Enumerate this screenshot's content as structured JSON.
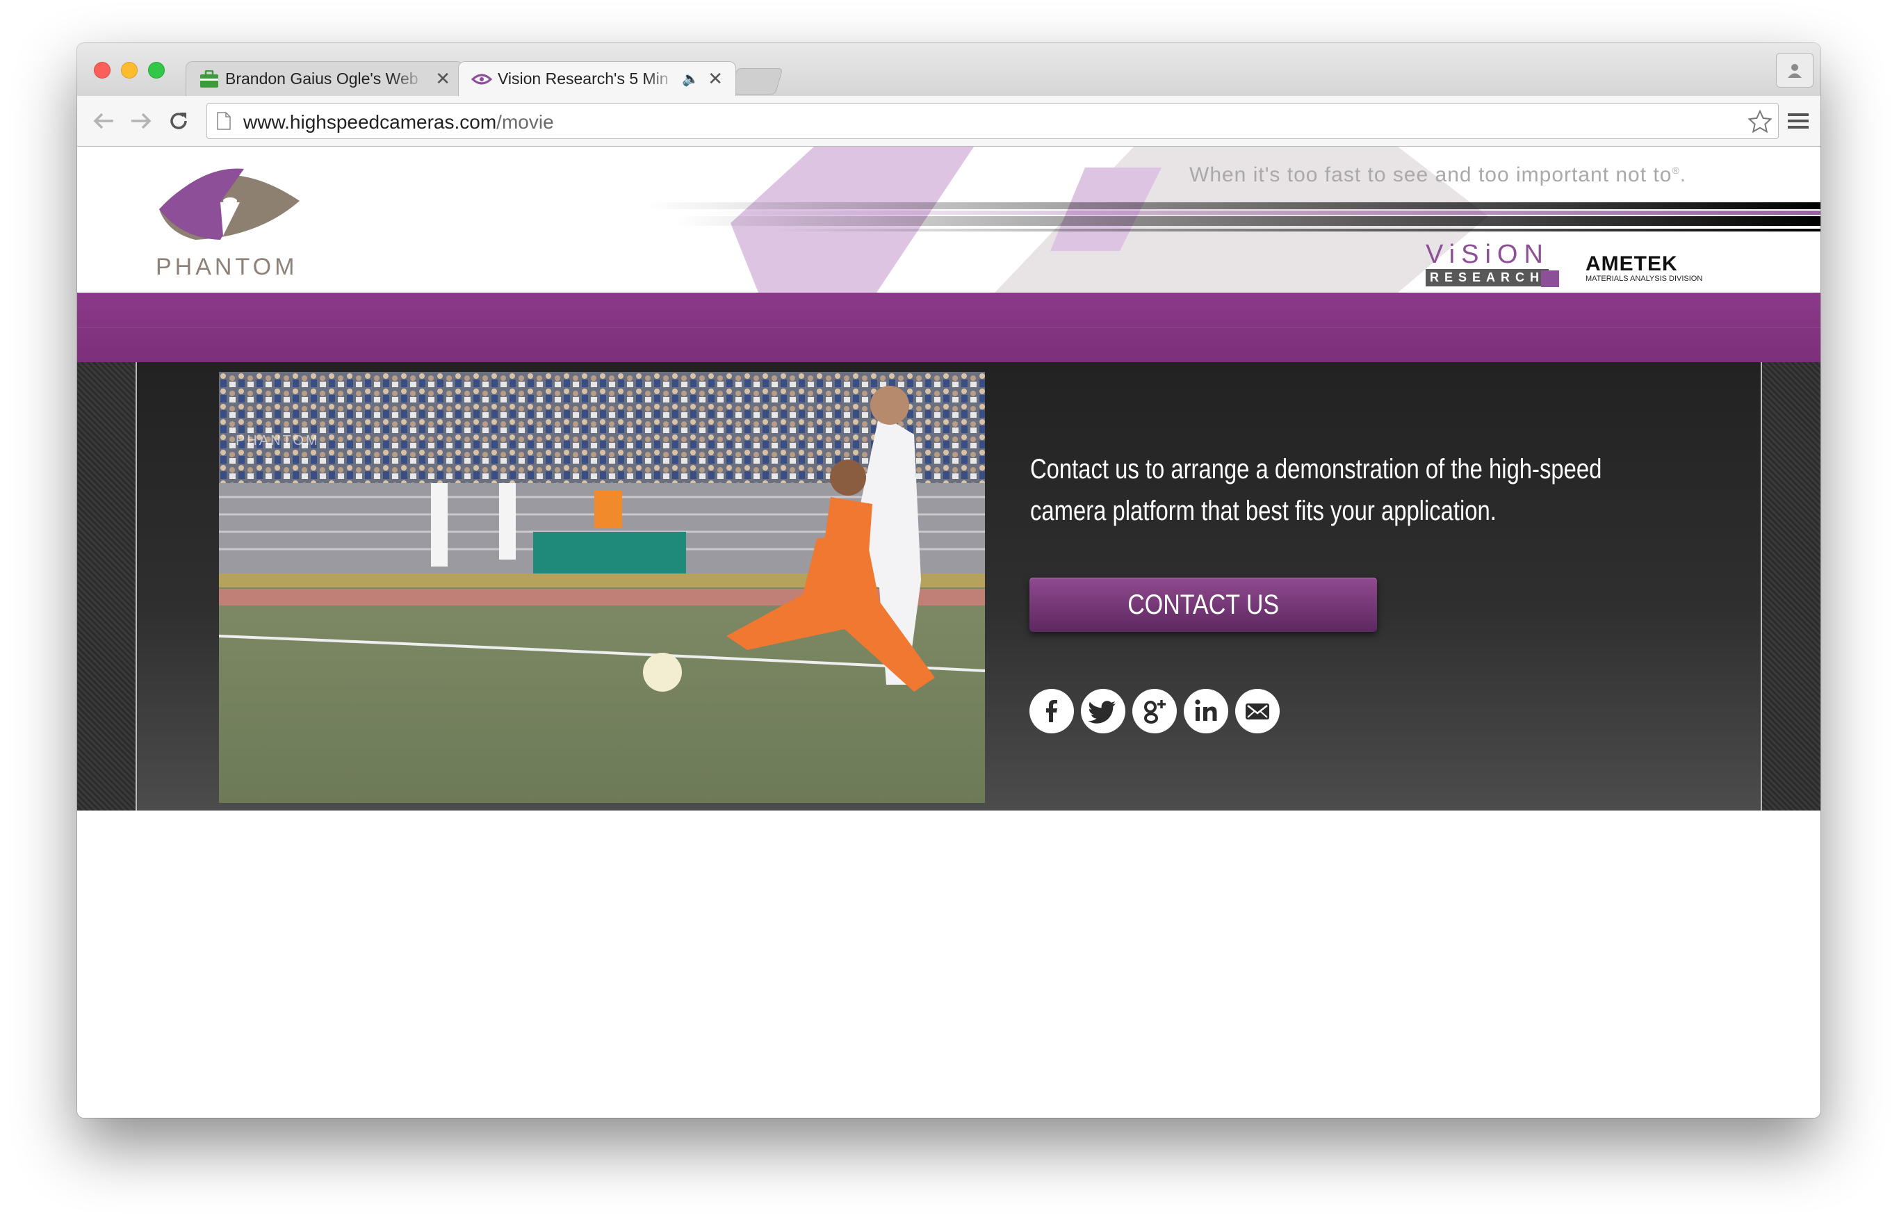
{
  "browser": {
    "tabs": [
      {
        "title": "Brandon Gaius Ogle's Web"
      },
      {
        "title": "Vision Research's 5 Min",
        "audio_icon": "🔈"
      }
    ],
    "close_symbol": "✕",
    "url_host": "www.highspeedcameras.com",
    "url_path": "/movie"
  },
  "header": {
    "tagline": "When it's too fast to see and too important not to",
    "tagline_mark": "®",
    "phantom_logo_text": "PHANTOM",
    "vision_logo_top": "ViSiON",
    "vision_logo_bottom": "RESEARCH",
    "ametek_logo": "AMETEK",
    "ametek_sub": "MATERIALS ANALYSIS DIVISION"
  },
  "hero": {
    "photo_watermark": "PHANTOM",
    "text": "Contact us to arrange a demonstration of the high-speed camera platform that best fits your application.",
    "contact_button": "CONTACT US",
    "social": [
      "facebook-icon",
      "twitter-icon",
      "google-plus-icon",
      "linkedin-icon",
      "email-icon"
    ]
  },
  "colors": {
    "brand_purple": "#7f3380",
    "header_gray": "#8e8177",
    "hero_dark": "#2b2b2b"
  }
}
